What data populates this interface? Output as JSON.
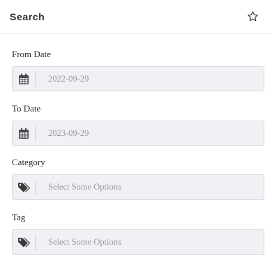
{
  "header": {
    "title": "Search",
    "favorite_icon": "star-outline-icon"
  },
  "fields": {
    "from_date": {
      "label": "From Date",
      "value": "2022-09-29",
      "icon": "calendar-icon"
    },
    "to_date": {
      "label": "To Date",
      "value": "2023-09-29",
      "icon": "calendar-icon"
    },
    "category": {
      "label": "Category",
      "placeholder": "Select Some Options",
      "icon": "tags-icon"
    },
    "tag": {
      "label": "Tag",
      "placeholder": "Select Some Options",
      "icon": "tags-icon"
    }
  },
  "colors": {
    "input_background": "#f1f0f5",
    "input_border": "#d9d8e0",
    "placeholder_text": "#9a9aa3"
  }
}
